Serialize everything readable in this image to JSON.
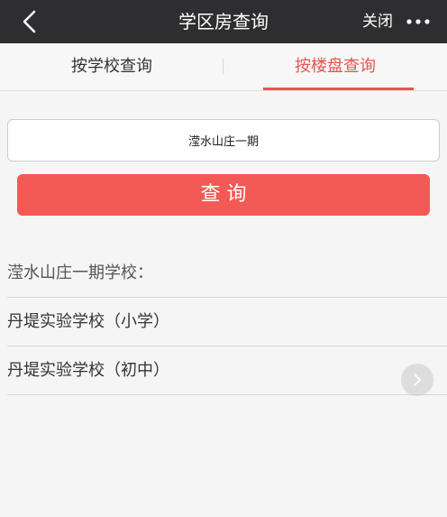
{
  "header": {
    "title": "学区房查询",
    "close_label": "关闭"
  },
  "tabs": [
    {
      "label": "按学校查询",
      "active": false
    },
    {
      "label": "按楼盘查询",
      "active": true
    }
  ],
  "search": {
    "value": "滢水山庄一期"
  },
  "query_button_label": "查 询",
  "results": {
    "heading": "滢水山庄一期学校：",
    "items": [
      {
        "label": "丹堤实验学校（小学）"
      },
      {
        "label": "丹堤实验学校（初中）"
      }
    ]
  },
  "colors": {
    "topbar": "#2e2e30",
    "accent": "#e8544f",
    "button": "#f45a55"
  },
  "icons": {
    "back": "chevron-left-icon",
    "more": "more-dots-icon",
    "scroll": "chevron-right-icon"
  }
}
